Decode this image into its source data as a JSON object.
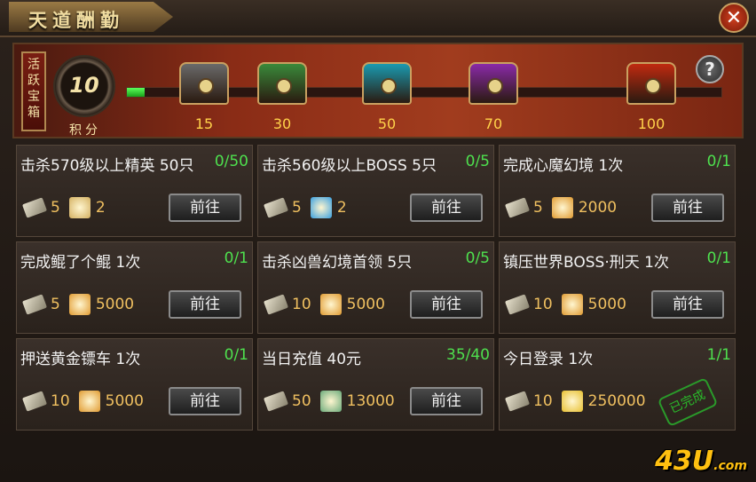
{
  "window": {
    "title": "天道酬勤",
    "close_icon": "close-icon"
  },
  "activity_box": {
    "tag": "活跃宝箱",
    "points_value": "10",
    "points_label": "积分",
    "progress": 0.03,
    "chests": [
      {
        "threshold": "15",
        "color": "#6a6a6a"
      },
      {
        "threshold": "30",
        "color": "#3a8a3a"
      },
      {
        "threshold": "50",
        "color": "#1a9ab0"
      },
      {
        "threshold": "70",
        "color": "#8a2aa8"
      },
      {
        "threshold": "100",
        "color": "#c02a10"
      }
    ],
    "help_label": "?"
  },
  "tasks": [
    {
      "name": "击杀570级以上精英 50只",
      "progress": "0/50",
      "reward_scroll": "5",
      "reward_item": "2",
      "item_icon": "map-icon",
      "item_color": "#d4b060",
      "button": "前往"
    },
    {
      "name": "击杀560级以上BOSS 5只",
      "progress": "0/5",
      "reward_scroll": "5",
      "reward_item": "2",
      "item_icon": "orb-icon",
      "item_color": "#3aa0e0",
      "button": "前往"
    },
    {
      "name": "完成心魔幻境 1次",
      "progress": "0/1",
      "reward_scroll": "5",
      "reward_item": "2000",
      "item_icon": "ticket-icon",
      "item_color": "#e09a30",
      "button": "前往"
    },
    {
      "name": "完成鲲了个鲲 1次",
      "progress": "0/1",
      "reward_scroll": "5",
      "reward_item": "5000",
      "item_icon": "ticket-icon",
      "item_color": "#e09a30",
      "button": "前往"
    },
    {
      "name": "击杀凶兽幻境首领 5只",
      "progress": "0/5",
      "reward_scroll": "10",
      "reward_item": "5000",
      "item_icon": "ticket-icon",
      "item_color": "#e09a30",
      "button": "前往"
    },
    {
      "name": "镇压世界BOSS·刑天 1次",
      "progress": "0/1",
      "reward_scroll": "10",
      "reward_item": "5000",
      "item_icon": "ticket-icon",
      "item_color": "#e09a30",
      "button": "前往"
    },
    {
      "name": "押送黄金镖车 1次",
      "progress": "0/1",
      "reward_scroll": "10",
      "reward_item": "5000",
      "item_icon": "ticket-icon",
      "item_color": "#e09a30",
      "button": "前往"
    },
    {
      "name": "当日充值 40元",
      "progress": "35/40",
      "reward_scroll": "50",
      "reward_item": "13000",
      "item_icon": "jade-icon",
      "item_color": "#6aaa7a",
      "button": "前往"
    },
    {
      "name": "今日登录 1次",
      "progress": "1/1",
      "reward_scroll": "10",
      "reward_item": "250000",
      "item_icon": "gold-ingot-icon",
      "item_color": "#e8c030",
      "button": "",
      "completed_stamp": "已完成"
    }
  ],
  "watermark": {
    "main": "43U",
    "suffix": ".com"
  }
}
